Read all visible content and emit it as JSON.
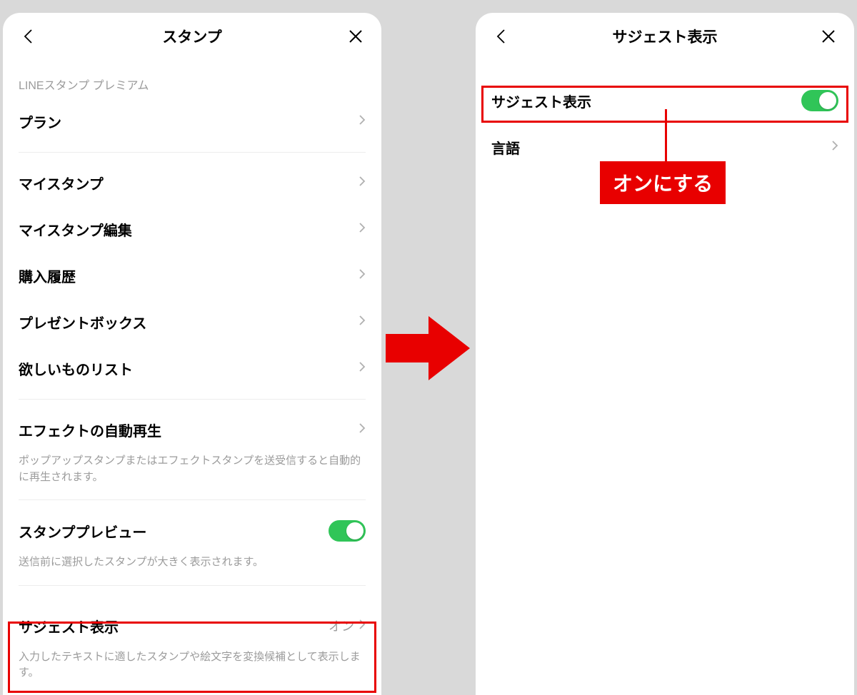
{
  "left": {
    "title": "スタンプ",
    "section_premium": "LINEスタンプ プレミアム",
    "items": {
      "plan": "プラン",
      "my_stamps": "マイスタンプ",
      "my_stamps_edit": "マイスタンプ編集",
      "purchase_history": "購入履歴",
      "present_box": "プレゼントボックス",
      "wishlist": "欲しいものリスト",
      "effect_autoplay": "エフェクトの自動再生",
      "effect_autoplay_desc": "ポップアップスタンプまたはエフェクトスタンプを送受信すると自動的に再生されます。",
      "stamp_preview": "スタンププレビュー",
      "stamp_preview_desc": "送信前に選択したスタンプが大きく表示されます。",
      "suggest": "サジェスト表示",
      "suggest_value": "オン",
      "suggest_desc": "入力したテキストに適したスタンプや絵文字を変換候補として表示します。"
    }
  },
  "right": {
    "title": "サジェスト表示",
    "items": {
      "suggest": "サジェスト表示",
      "language": "言語"
    }
  },
  "annotation": {
    "callout": "オンにする"
  }
}
